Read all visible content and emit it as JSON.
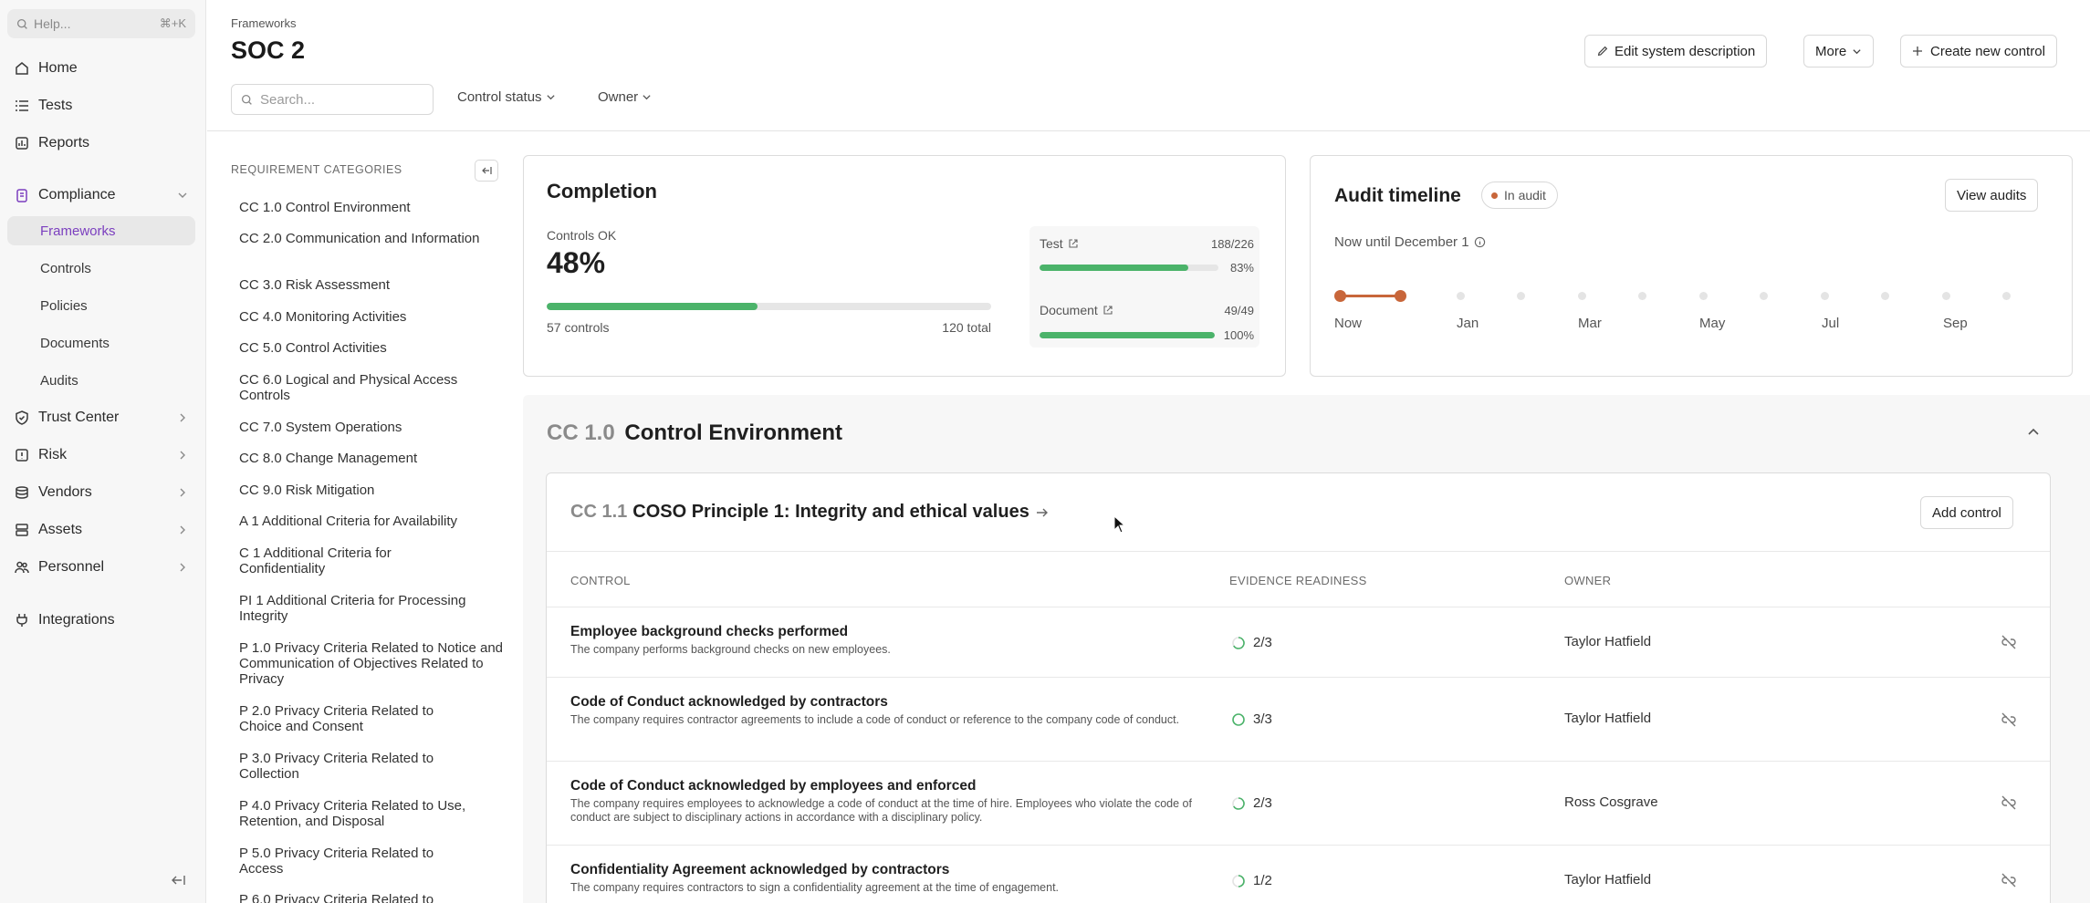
{
  "sidebar": {
    "help_placeholder": "Help...",
    "help_shortcut": "⌘+K",
    "items": [
      {
        "label": "Home",
        "icon": "home-icon"
      },
      {
        "label": "Tests",
        "icon": "list-icon"
      },
      {
        "label": "Reports",
        "icon": "report-icon"
      },
      {
        "label": "Compliance",
        "icon": "clipboard-icon"
      },
      {
        "label": "Trust Center",
        "icon": "shield-icon"
      },
      {
        "label": "Risk",
        "icon": "alert-icon"
      },
      {
        "label": "Vendors",
        "icon": "vendor-icon"
      },
      {
        "label": "Assets",
        "icon": "server-icon"
      },
      {
        "label": "Personnel",
        "icon": "people-icon"
      },
      {
        "label": "Integrations",
        "icon": "plug-icon"
      }
    ],
    "compliance_sub": [
      "Frameworks",
      "Controls",
      "Policies",
      "Documents",
      "Audits"
    ]
  },
  "header": {
    "breadcrumb": "Frameworks",
    "title": "SOC 2",
    "edit_button": "Edit system description",
    "more_button": "More",
    "create_button": "Create new control",
    "search_placeholder": "Search...",
    "filter_status": "Control status",
    "filter_owner": "Owner"
  },
  "categories": {
    "heading": "REQUIREMENT CATEGORIES",
    "items": [
      "CC 1.0 Control Environment",
      "CC 2.0 Communication and Information",
      "CC 3.0 Risk Assessment",
      "CC 4.0 Monitoring Activities",
      "CC 5.0 Control Activities",
      "CC 6.0 Logical and Physical Access Controls",
      "CC 7.0 System Operations",
      "CC 8.0 Change Management",
      "CC 9.0 Risk Mitigation",
      "A 1 Additional Criteria for Availability",
      "C 1 Additional Criteria for Confidentiality",
      "PI 1 Additional Criteria for Processing Integrity",
      "P 1.0 Privacy Criteria Related to Notice and Communication of Objectives Related to Privacy",
      "P 2.0 Privacy Criteria Related to Choice and Consent",
      "P 3.0 Privacy Criteria Related to Collection",
      "P 4.0 Privacy Criteria Related to Use, Retention, and Disposal",
      "P 5.0 Privacy Criteria Related to Access",
      "P 6.0 Privacy Criteria Related to"
    ]
  },
  "completion": {
    "title": "Completion",
    "controls_ok_label": "Controls OK",
    "percent": "48%",
    "progress": 0.475,
    "controls_count": "57 controls",
    "total": "120 total",
    "test_label": "Test",
    "test_count": "188/226",
    "test_percent": "83%",
    "test_progress": 0.83,
    "doc_label": "Document",
    "doc_count": "49/49",
    "doc_percent": "100%",
    "doc_progress": 1.0
  },
  "audit": {
    "title": "Audit timeline",
    "badge": "In audit",
    "view_button": "View audits",
    "subtitle": "Now until December 1",
    "months": [
      "Now",
      "Jan",
      "Mar",
      "May",
      "Jul",
      "Sep"
    ]
  },
  "section": {
    "code": "CC 1.0",
    "title": "Control Environment",
    "sub_code": "CC 1.1",
    "sub_title": "COSO Principle 1: Integrity and ethical values",
    "add_button": "Add control",
    "col_control": "CONTROL",
    "col_readiness": "EVIDENCE READINESS",
    "col_owner": "OWNER",
    "rows": [
      {
        "title": "Employee background checks performed",
        "desc": "The company performs background checks on new employees.",
        "readiness": "2/3",
        "owner": "Taylor Hatfield"
      },
      {
        "title": "Code of Conduct acknowledged by contractors",
        "desc": "The company requires contractor agreements to include a code of conduct or reference to the company code of conduct.",
        "readiness": "3/3",
        "owner": "Taylor Hatfield"
      },
      {
        "title": "Code of Conduct acknowledged by employees and enforced",
        "desc": "The company requires employees to acknowledge a code of conduct at the time of hire. Employees who violate the code of conduct are subject to disciplinary actions in accordance with a disciplinary policy.",
        "readiness": "2/3",
        "owner": "Ross Cosgrave"
      },
      {
        "title": "Confidentiality Agreement acknowledged by contractors",
        "desc": "The company requires contractors to sign a confidentiality agreement at the time of engagement.",
        "readiness": "1/2",
        "owner": "Taylor Hatfield"
      }
    ]
  },
  "colors": {
    "accent": "#7b3fbf",
    "success": "#4bb36a",
    "timeline": "#c8663a"
  }
}
